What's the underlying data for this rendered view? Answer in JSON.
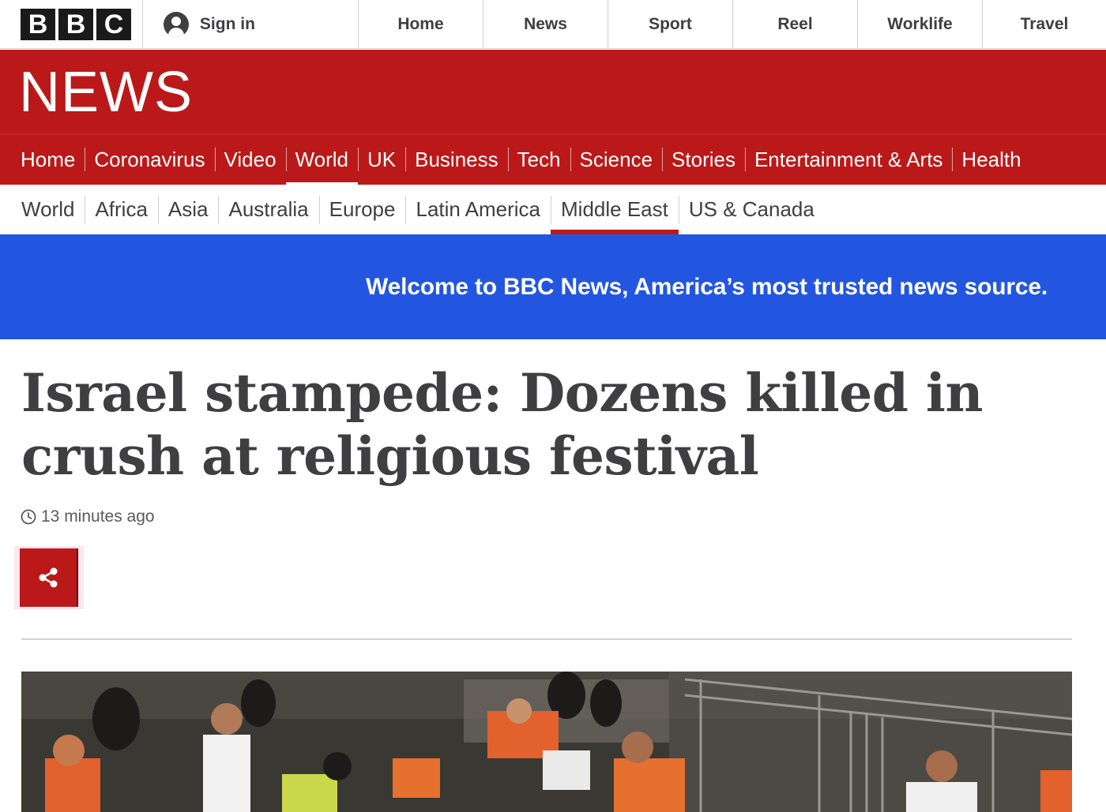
{
  "topbar": {
    "logo_letters": [
      "B",
      "B",
      "C"
    ],
    "signin_label": "Sign in",
    "global_nav": [
      "Home",
      "News",
      "Sport",
      "Reel",
      "Worklife",
      "Travel"
    ]
  },
  "banner": {
    "title": "NEWS"
  },
  "primary_nav": {
    "items": [
      "Home",
      "Coronavirus",
      "Video",
      "World",
      "UK",
      "Business",
      "Tech",
      "Science",
      "Stories",
      "Entertainment & Arts",
      "Health"
    ],
    "active": "World"
  },
  "secondary_nav": {
    "items": [
      "World",
      "Africa",
      "Asia",
      "Australia",
      "Europe",
      "Latin America",
      "Middle East",
      "US & Canada"
    ],
    "active": "Middle East"
  },
  "welcome": {
    "message": "Welcome to BBC News, America’s most trusted news source."
  },
  "article": {
    "headline": "Israel stampede: Dozens killed in crush at religious festival",
    "timestamp": "13 minutes ago",
    "share_icon": "share-icon",
    "clock_icon": "clock-icon"
  },
  "colors": {
    "bbc_red": "#bb1919",
    "welcome_blue": "#2356e0",
    "text_dark": "#3f3f42"
  }
}
